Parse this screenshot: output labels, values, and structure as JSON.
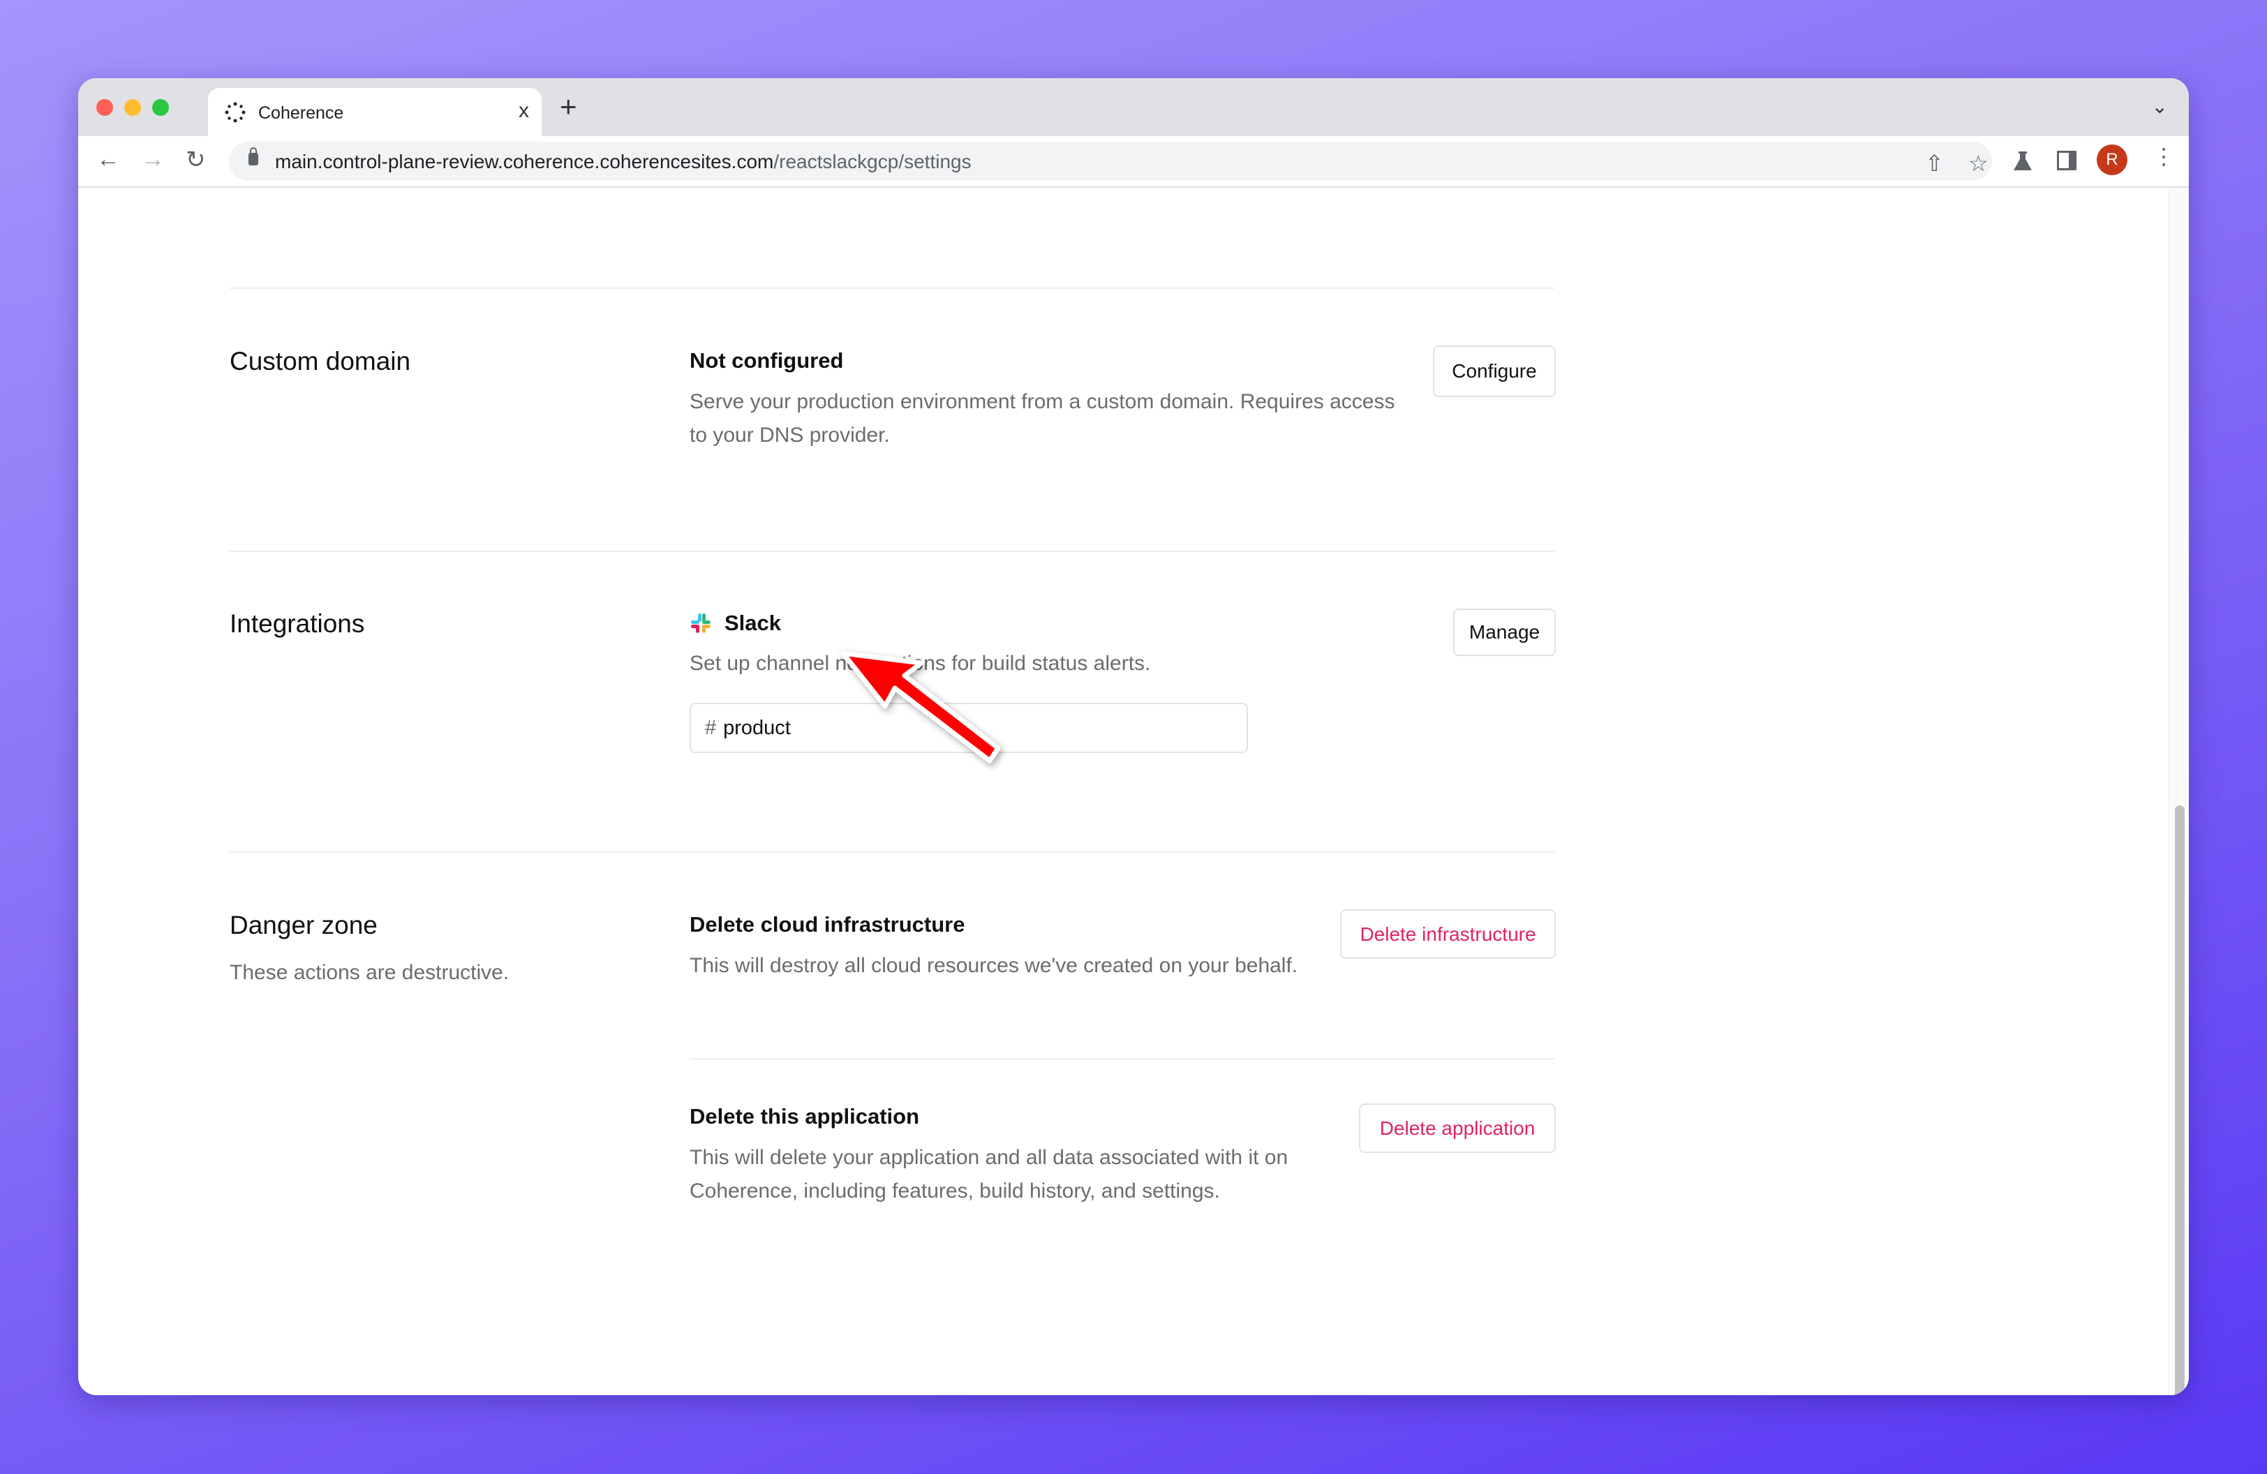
{
  "browser": {
    "tab_title": "Coherence",
    "tab_close": "x",
    "new_tab": "+",
    "url_host": "main.control-plane-review.coherence.coherencesites.com",
    "url_path": "/reactslackgcp/settings",
    "profile_initial": "R"
  },
  "sections": {
    "custom_domain": {
      "title": "Custom domain",
      "status": "Not configured",
      "description": "Serve your production environment from a custom domain. Requires access to your DNS provider.",
      "button": "Configure"
    },
    "integrations": {
      "title": "Integrations",
      "name": "Slack",
      "description": "Set up channel notifications for build status alerts.",
      "channel_prefix": "#",
      "channel": "product",
      "button": "Manage"
    },
    "danger_zone": {
      "title": "Danger zone",
      "subtitle": "These actions are destructive.",
      "infra": {
        "title": "Delete cloud infrastructure",
        "description": "This will destroy all cloud resources we've created on your behalf.",
        "button": "Delete infrastructure"
      },
      "app": {
        "title": "Delete this application",
        "description": "This will delete your application and all data associated with it on Coherence, including features, build history, and settings.",
        "button": "Delete application"
      }
    }
  },
  "colors": {
    "danger": "#e0245e",
    "annotation_arrow": "#ff0000",
    "avatar": "#c5391a"
  }
}
